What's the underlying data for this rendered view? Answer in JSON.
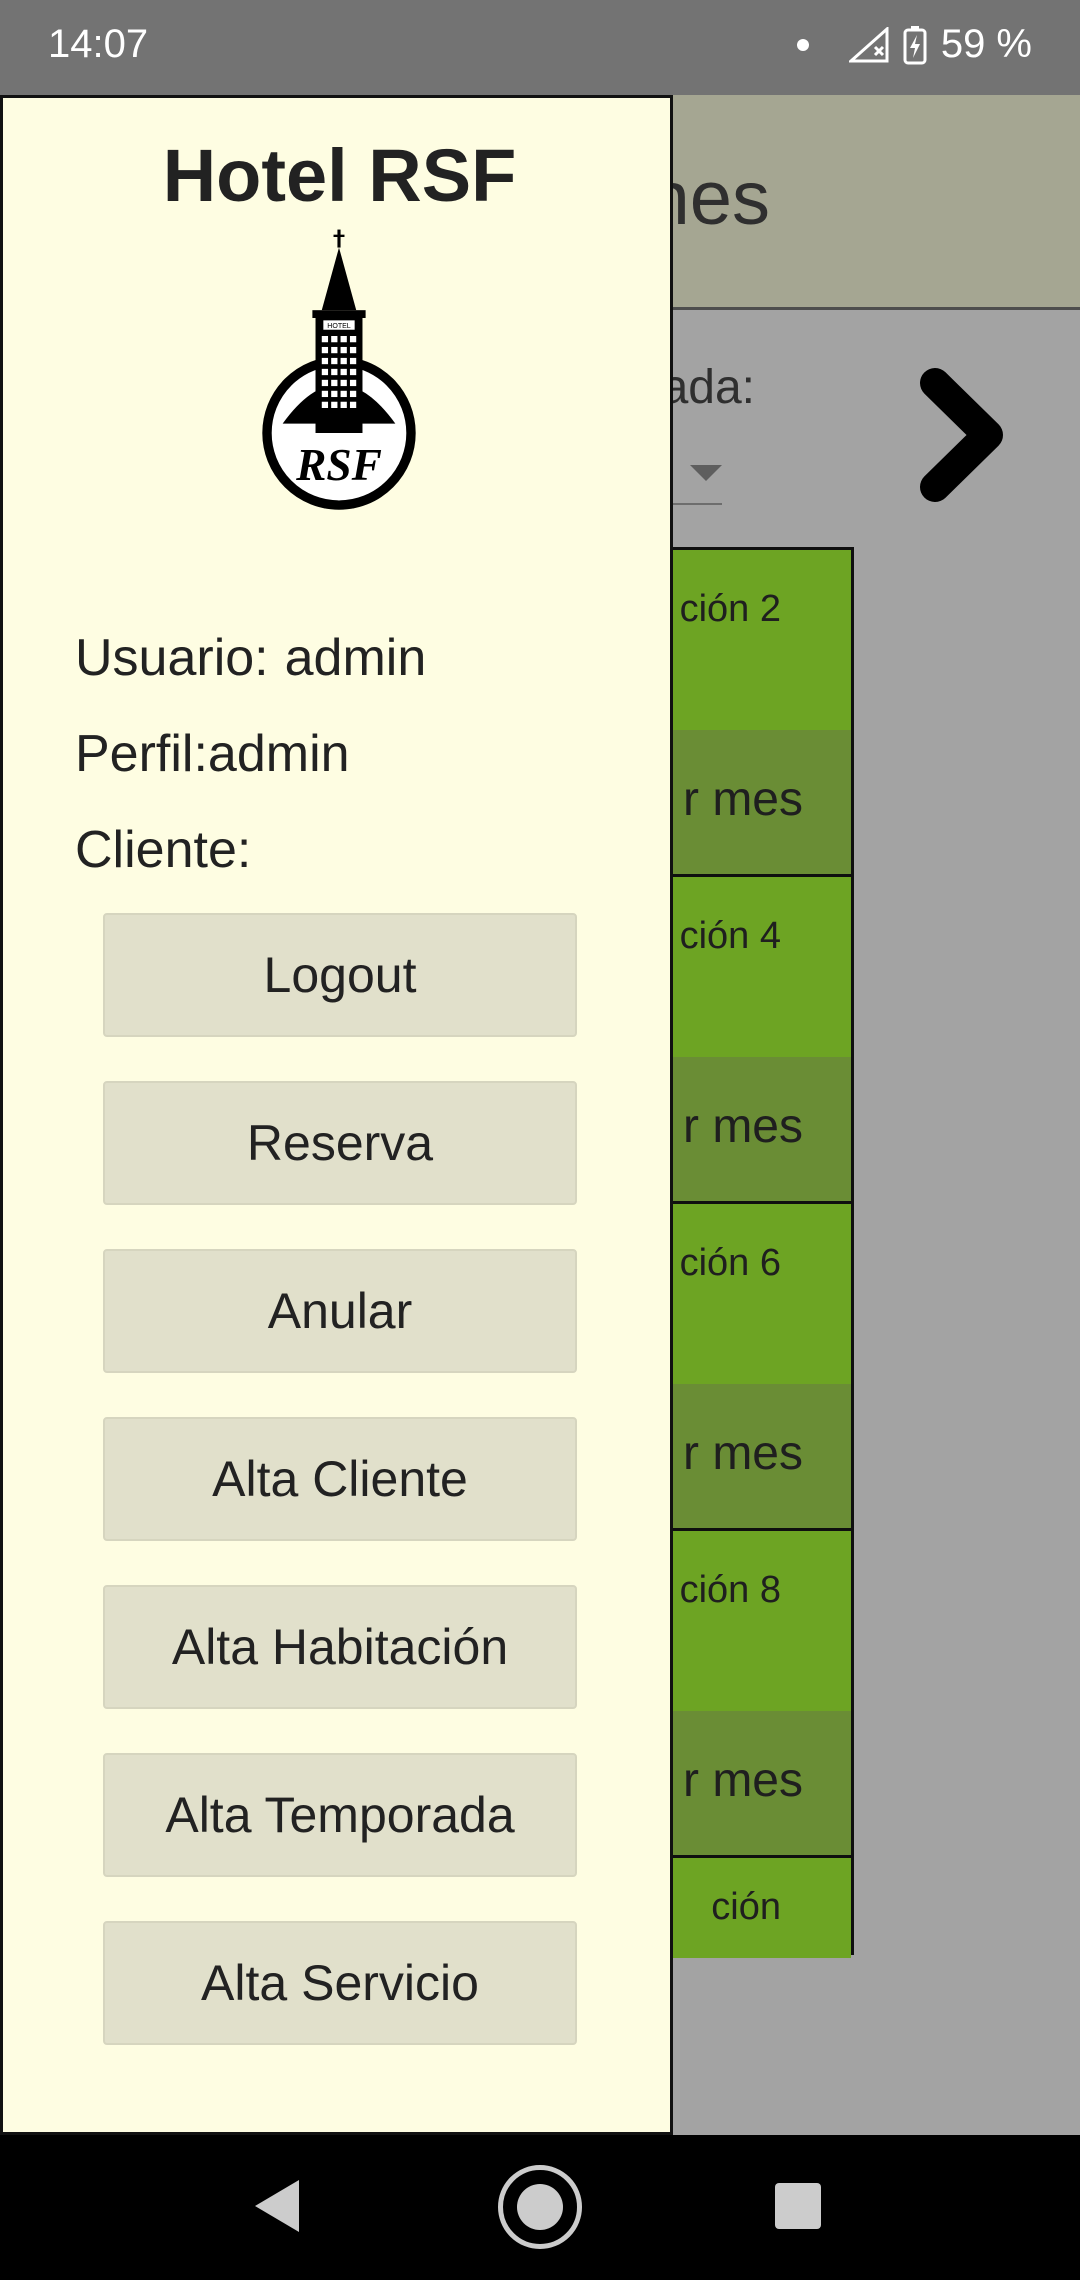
{
  "status_bar": {
    "time": "14:07",
    "battery": "59 %",
    "icons": [
      "notification-dot-icon",
      "signal-icon",
      "battery-icon"
    ]
  },
  "background_app": {
    "header_title": "nes",
    "season_label": "ada:",
    "next_icon": "chevron-right-icon",
    "rooms": [
      {
        "name": "ción 2",
        "month": "r mes"
      },
      {
        "name": "ción 4",
        "month": "r mes"
      },
      {
        "name": "ción 6",
        "month": "r mes"
      },
      {
        "name": "ción 8",
        "month": "r mes"
      },
      {
        "name": "ción",
        "month": ""
      }
    ]
  },
  "drawer": {
    "title": "Hotel RSF",
    "logo_text": "RSF",
    "logo_tower_text": "HOTEL",
    "user_label": "Usuario:",
    "user_value": "admin",
    "profile_label": "Perfil:",
    "profile_value": "admin",
    "client_label": "Cliente:",
    "client_value": "",
    "buttons": [
      {
        "label": "Logout"
      },
      {
        "label": "Reserva"
      },
      {
        "label": "Anular"
      },
      {
        "label": "Alta Cliente"
      },
      {
        "label": "Alta Habitación"
      },
      {
        "label": "Alta Temporada"
      },
      {
        "label": "Alta Servicio"
      }
    ]
  },
  "colors": {
    "drawer_bg": "#fefde2",
    "button_bg": "#e1e0cb",
    "room_green": "#77b226",
    "room_green_dark": "#73993a",
    "app_header": "#b4b59f"
  },
  "nav_bar": {
    "icons": [
      "back-icon",
      "home-icon",
      "recents-icon"
    ]
  }
}
